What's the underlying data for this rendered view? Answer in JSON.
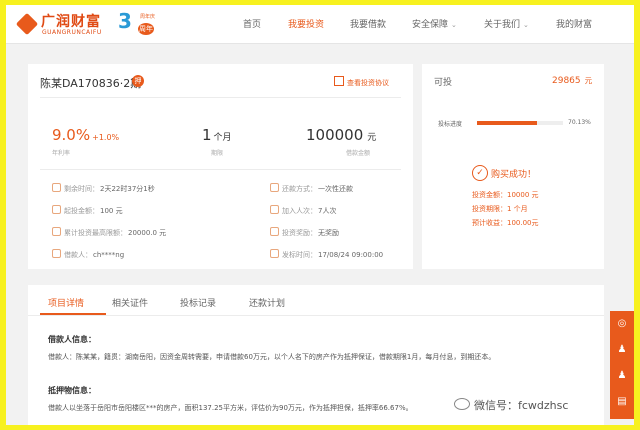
{
  "brand": {
    "logo_cn": "广润财富",
    "logo_en": "GUANGRUNCAIFU",
    "anniv_num": "3",
    "anniv_badge": "周年",
    "anniv_tiny": "周年庆"
  },
  "nav": [
    "首页",
    "我要投资",
    "我要借款",
    "安全保障",
    "关于我们",
    "我的财富"
  ],
  "nav_active": 1,
  "loan": {
    "title": "陈某DA170836·2期",
    "title_badge": "押",
    "protocol_link": "查看投资协议",
    "rate": "9.0%",
    "rate_bonus": "+1.0%",
    "rate_label": "年利率",
    "period_num": "1",
    "period_unit": "个月",
    "period_label": "期限",
    "amount": "100000",
    "amount_unit": "元",
    "amount_label": "借款金额",
    "info": [
      {
        "k": "剩余时间：",
        "v": "2天22时37分1秒"
      },
      {
        "k": "还款方式：",
        "v": "一次性还款"
      },
      {
        "k": "起投金额：",
        "v": "100 元"
      },
      {
        "k": "加入人次：",
        "v": "7人次"
      },
      {
        "k": "累计投资最高限额：",
        "v": "20000.0 元"
      },
      {
        "k": "投资奖励：",
        "v": "无奖励"
      },
      {
        "k": "借款人：",
        "v": "ch****ng"
      },
      {
        "k": "发标时间：",
        "v": "17/08/24 09:00:00"
      }
    ]
  },
  "invest": {
    "available_label": "可投",
    "available_value": "29865",
    "available_unit": "元",
    "progress_label": "投标进度",
    "progress": 70.13,
    "progress_text": "70.13%",
    "success_text": "购买成功！",
    "rows": [
      {
        "k": "投资金额：",
        "v": "10000 元"
      },
      {
        "k": "投资期限：",
        "v": "1 个月"
      },
      {
        "k": "预计收益：",
        "v": "100.00元"
      }
    ]
  },
  "tabs": [
    "项目详情",
    "相关证件",
    "投标记录",
    "还款计划"
  ],
  "tab_active": 0,
  "detail": {
    "borrower_title": "借款人信息：",
    "borrower_body": "借款人：陈某某，籍贯：湖南岳阳，因资金周转需要，申请借款60万元，以个人名下的房产作为抵押保证，借款期限1月，每月付息，到期还本。",
    "collateral_title": "抵押物信息：",
    "collateral_body": "借款人以坐落于岳阳市岳阳楼区***的房产，面积137.25平方米，评估价为90万元，作为抵押担保，抵押率66.67%。"
  },
  "watermark": "微信号：fcwdzhsc",
  "accent": "#e85a1c"
}
